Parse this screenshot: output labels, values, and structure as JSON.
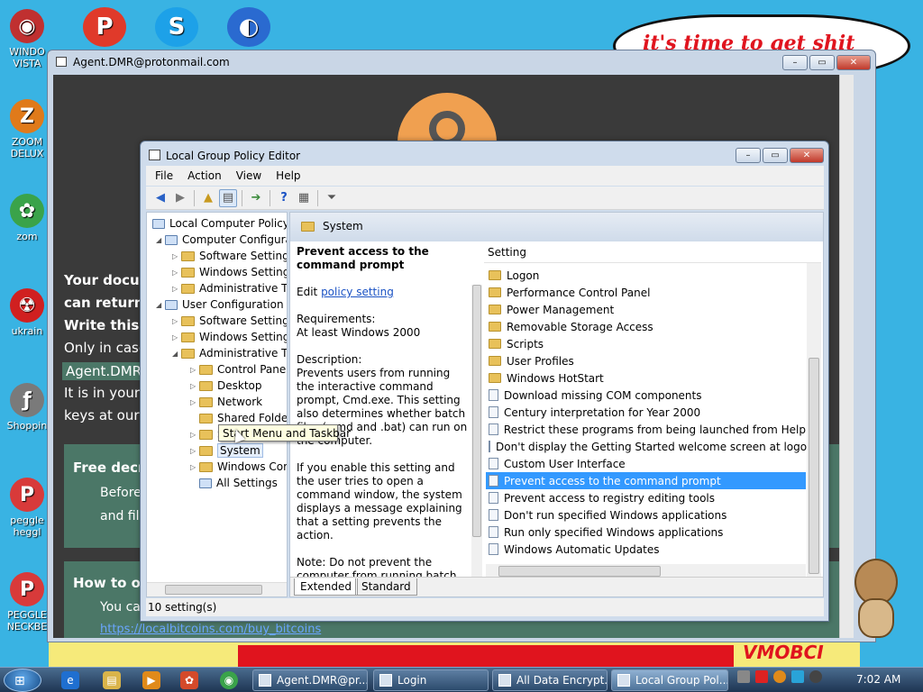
{
  "desktop": {
    "icons": [
      {
        "label": "WINDO VISTA",
        "color": "#c03030",
        "glyph": "◉"
      },
      {
        "label": "ZOOM DELUX",
        "color": "#e07a1a",
        "glyph": "Z"
      },
      {
        "label": "zom",
        "color": "#3aa34a",
        "glyph": "✿"
      },
      {
        "label": "ukrain",
        "color": "#d02020",
        "glyph": "☢"
      },
      {
        "label": "Shoppin",
        "color": "#7a7a7a",
        "glyph": "ƒ"
      },
      {
        "label": "peggle heggl",
        "color": "#d83a3a",
        "glyph": "P"
      },
      {
        "label": "PEGGLE NECKBE",
        "color": "#d83a3a",
        "glyph": "P"
      }
    ],
    "top_icons": [
      {
        "name": "red-ball-icon",
        "color": "#e03a2a",
        "glyph": "P"
      },
      {
        "name": "skype-icon",
        "color": "#1da1e8",
        "glyph": "S"
      },
      {
        "name": "globe-icon",
        "color": "#2a6ad0",
        "glyph": "◐"
      }
    ],
    "bubble_text": "it's time to get shit",
    "banner_text": "VMOBCI"
  },
  "browser_window": {
    "title": "Agent.DMR@protonmail.com",
    "lines": [
      {
        "text": "Your docum",
        "bold": true
      },
      {
        "text": "can return a",
        "bold": true
      },
      {
        "text": "Write this I",
        "bold": true
      },
      {
        "text": "Only in case",
        "bold": false
      },
      {
        "text": "Agent.DMR@",
        "bold": false
      },
      {
        "text": "It is in your in",
        "bold": false
      },
      {
        "text": "keys at our s",
        "bold": false
      }
    ],
    "box1": {
      "title": "Free decry",
      "line1": "Before",
      "line2": "and file"
    },
    "box2": {
      "title": "How to ob",
      "line1": "You ca",
      "link": "https://localbitcoins.com/buy_bitcoins"
    }
  },
  "gpedit": {
    "title": "Local Group Policy Editor",
    "menu": [
      "File",
      "Action",
      "View",
      "Help"
    ],
    "tree": [
      {
        "label": "Local Computer Policy",
        "indent": 0,
        "tri": "",
        "kind": "root"
      },
      {
        "label": "Computer Configura",
        "indent": 1,
        "tri": "◢",
        "kind": "comp"
      },
      {
        "label": "Software Settings",
        "indent": 2,
        "tri": "▷",
        "kind": "folder"
      },
      {
        "label": "Windows Setting",
        "indent": 2,
        "tri": "▷",
        "kind": "folder"
      },
      {
        "label": "Administrative Te",
        "indent": 2,
        "tri": "▷",
        "kind": "folder"
      },
      {
        "label": "User Configuration",
        "indent": 1,
        "tri": "◢",
        "kind": "user"
      },
      {
        "label": "Software Settings",
        "indent": 2,
        "tri": "▷",
        "kind": "folder"
      },
      {
        "label": "Windows Setting",
        "indent": 2,
        "tri": "▷",
        "kind": "folder"
      },
      {
        "label": "Administrative Te",
        "indent": 2,
        "tri": "◢",
        "kind": "folder"
      },
      {
        "label": "Control Panel",
        "indent": 3,
        "tri": "▷",
        "kind": "folder"
      },
      {
        "label": "Desktop",
        "indent": 3,
        "tri": "▷",
        "kind": "folder"
      },
      {
        "label": "Network",
        "indent": 3,
        "tri": "▷",
        "kind": "folder"
      },
      {
        "label": "Shared Folder",
        "indent": 3,
        "tri": "",
        "kind": "folder"
      },
      {
        "label": "Start Menu and Taskbar",
        "indent": 3,
        "tri": "▷",
        "kind": "folder"
      },
      {
        "label": "System",
        "indent": 3,
        "tri": "▷",
        "kind": "folder"
      },
      {
        "label": "Windows Cor",
        "indent": 3,
        "tri": "▷",
        "kind": "folder"
      },
      {
        "label": "All Settings",
        "indent": 3,
        "tri": "",
        "kind": "all"
      }
    ],
    "tooltip": "Start Menu and Taskbar",
    "pane_title": "System",
    "desc": {
      "heading": "Prevent access to the command prompt",
      "edit_prefix": "Edit ",
      "edit_link": "policy setting",
      "req_label": "Requirements:",
      "req_value": "At least Windows 2000",
      "desc_label": "Description:",
      "desc_text": "Prevents users from running the interactive command prompt, Cmd.exe. This setting also determines whether batch files (.cmd and .bat) can run on the computer.",
      "enable_text": "If you enable this setting and the user tries to open a command window, the system displays a message explaining that a setting prevents the action.",
      "note_text": "Note: Do not prevent the computer from running batch files if the computer uses logon"
    },
    "list_header": "Setting",
    "items": [
      {
        "label": "Logon",
        "type": "folder"
      },
      {
        "label": "Performance Control Panel",
        "type": "folder"
      },
      {
        "label": "Power Management",
        "type": "folder"
      },
      {
        "label": "Removable Storage Access",
        "type": "folder"
      },
      {
        "label": "Scripts",
        "type": "folder"
      },
      {
        "label": "User Profiles",
        "type": "folder"
      },
      {
        "label": "Windows HotStart",
        "type": "folder"
      },
      {
        "label": "Download missing COM components",
        "type": "setting"
      },
      {
        "label": "Century interpretation for Year 2000",
        "type": "setting"
      },
      {
        "label": "Restrict these programs from being launched from Help",
        "type": "setting"
      },
      {
        "label": "Don't display the Getting Started welcome screen at logon",
        "type": "setting"
      },
      {
        "label": "Custom User Interface",
        "type": "setting"
      },
      {
        "label": "Prevent access to the command prompt",
        "type": "setting",
        "selected": true
      },
      {
        "label": "Prevent access to registry editing tools",
        "type": "setting"
      },
      {
        "label": "Don't run specified Windows applications",
        "type": "setting"
      },
      {
        "label": "Run only specified Windows applications",
        "type": "setting"
      },
      {
        "label": "Windows Automatic Updates",
        "type": "setting"
      }
    ],
    "tabs": [
      "Extended",
      "Standard"
    ],
    "status": "10 setting(s)"
  },
  "taskbar": {
    "buttons": [
      {
        "label": "Agent.DMR@pr...",
        "active": false
      },
      {
        "label": "Login",
        "active": false
      },
      {
        "label": "All Data Encrypt...",
        "active": false
      },
      {
        "label": "Local Group Pol...",
        "active": true
      }
    ],
    "clock": "7:02 AM"
  },
  "colors": {
    "accent": "#3399ff",
    "link": "#1a52c4",
    "desktop": "#39b3e3"
  }
}
